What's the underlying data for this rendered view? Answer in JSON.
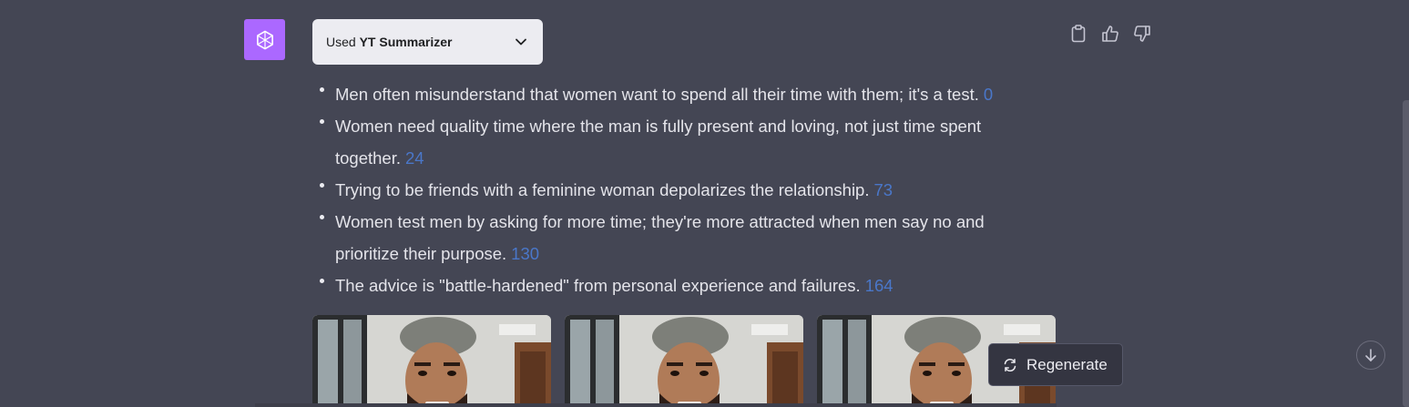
{
  "plugin": {
    "used_label": "Used",
    "plugin_name": "YT Summarizer"
  },
  "message": {
    "bullets": [
      {
        "text": "Men often misunderstand that women want to spend all their time with them; it's a test.",
        "timestamp": "0"
      },
      {
        "text": "Women need quality time where the man is fully present and loving, not just time spent together.",
        "timestamp": "24"
      },
      {
        "text": "Trying to be friends with a feminine woman depolarizes the relationship.",
        "timestamp": "73"
      },
      {
        "text": "Women test men by asking for more time; they're more attracted when men say no and prioritize their purpose.",
        "timestamp": "130"
      },
      {
        "text": "The advice is \"battle-hardened\" from personal experience and failures.",
        "timestamp": "164"
      }
    ]
  },
  "actions": {
    "copy_icon": "clipboard-icon",
    "thumbs_up_icon": "thumbs-up-icon",
    "thumbs_down_icon": "thumbs-down-icon"
  },
  "regenerate": {
    "label": "Regenerate"
  },
  "colors": {
    "background": "#444654",
    "avatar": "#ab68ff",
    "timestamp_link": "#4a77c9"
  }
}
